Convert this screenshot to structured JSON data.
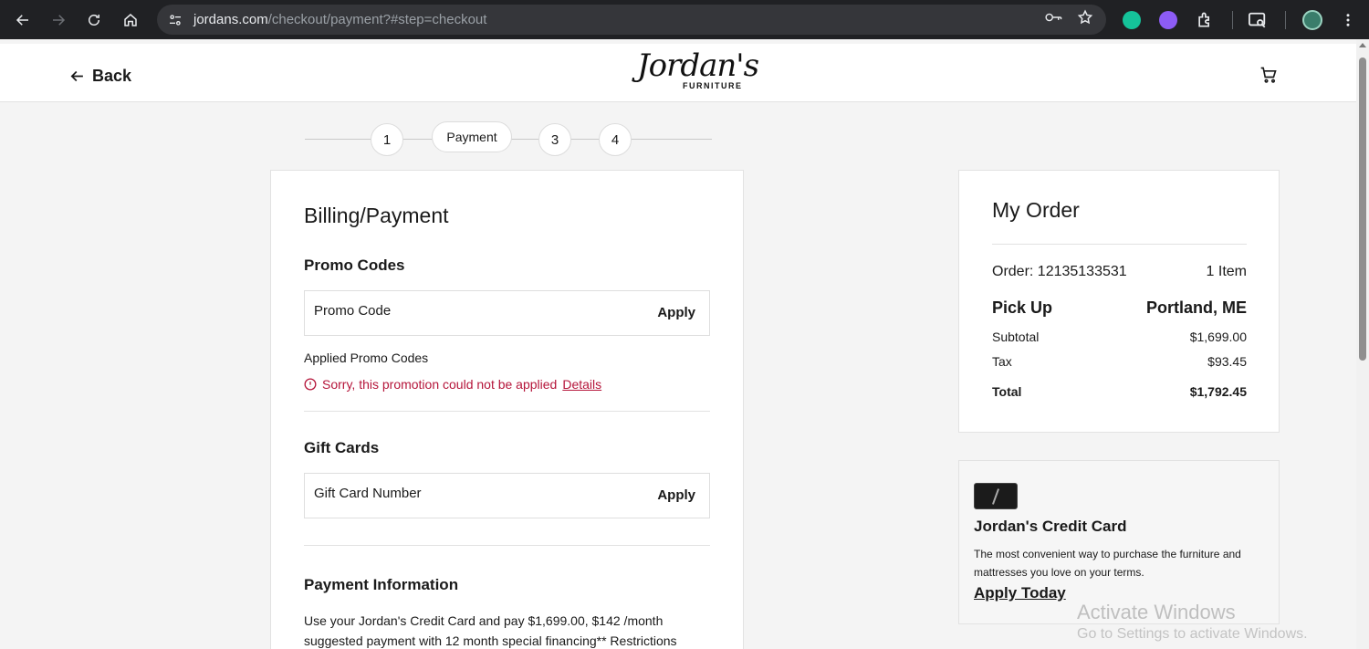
{
  "browser": {
    "url_host": "jordans.com",
    "url_path": "/checkout/payment?#step=checkout"
  },
  "header": {
    "back_label": "Back",
    "logo_text": "Jordan's",
    "logo_subtext": "FURNITURE"
  },
  "stepper": {
    "steps": [
      "1",
      "Payment",
      "3",
      "4"
    ]
  },
  "billing": {
    "title": "Billing/Payment",
    "promo": {
      "heading": "Promo Codes",
      "placeholder": "Promo Code",
      "apply_label": "Apply",
      "applied_label": "Applied Promo Codes",
      "error_text": "Sorry, this promotion could not be applied",
      "details_link": "Details"
    },
    "gift": {
      "heading": "Gift Cards",
      "placeholder": "Gift Card Number",
      "apply_label": "Apply"
    },
    "payment": {
      "heading": "Payment Information",
      "text": "Use your Jordan's Credit Card and pay $1,699.00, $142 /month suggested payment with 12 month special financing** Restrictions"
    }
  },
  "order": {
    "title": "My Order",
    "order_label": "Order: 12135133531",
    "items_count": "1 Item",
    "pickup_label": "Pick Up",
    "pickup_location": "Portland, ME",
    "subtotal_label": "Subtotal",
    "subtotal_value": "$1,699.00",
    "tax_label": "Tax",
    "tax_value": "$93.45",
    "total_label": "Total",
    "total_value": "$1,792.45"
  },
  "credit": {
    "title": "Jordan's Credit Card",
    "description": "The most convenient way to purchase the furniture and mattresses you love on your terms.",
    "cta": "Apply Today"
  },
  "watermark": {
    "line1": "Activate Windows",
    "line2": "Go to Settings to activate Windows."
  },
  "colors": {
    "error": "#b5153a",
    "chrome_bg": "#202124",
    "page_bg": "#f4f4f4"
  }
}
